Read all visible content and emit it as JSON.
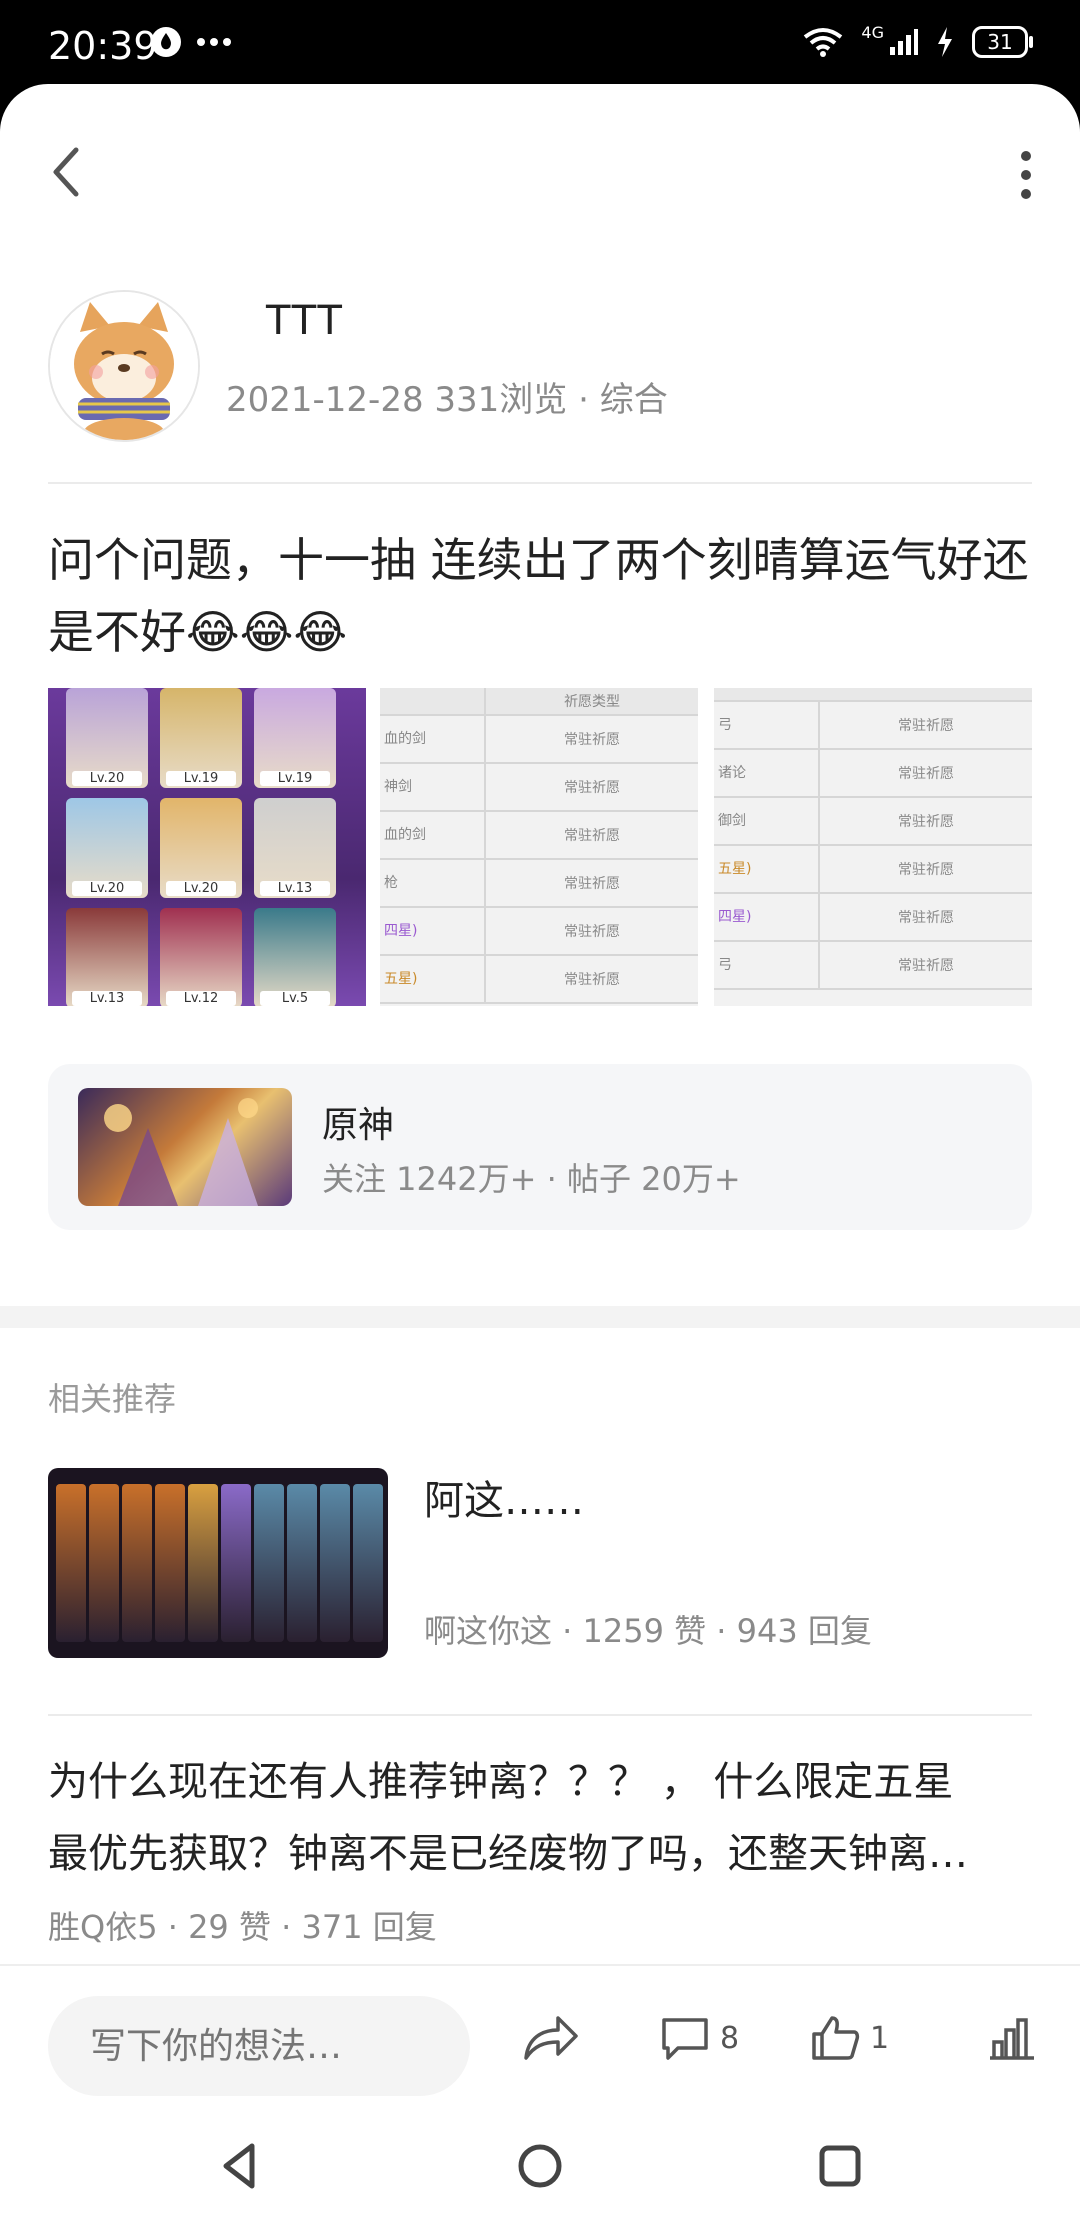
{
  "status_bar": {
    "time": "20:39",
    "network": "4G",
    "battery": "31"
  },
  "author": {
    "name": "TTT",
    "meta": "2021-12-28  331浏览 · 综合"
  },
  "post": {
    "title": "问个问题，十一抽 连续出了两个刻晴算运气好还是不好😂😂😂",
    "image1_levels": [
      "Lv.20",
      "Lv.19",
      "Lv.19",
      "Lv.20",
      "Lv.20",
      "Lv.13",
      "Lv.13",
      "Lv.12",
      "Lv.5"
    ],
    "table_header": "祈愿类型",
    "table_rows_1": [
      {
        "name": "血的剑",
        "type": "常驻祈愿"
      },
      {
        "name": "神剑",
        "type": "常驻祈愿"
      },
      {
        "name": "血的剑",
        "type": "常驻祈愿"
      },
      {
        "name": "枪",
        "type": "常驻祈愿"
      },
      {
        "name": "四星)",
        "type": "常驻祈愿"
      },
      {
        "name": "五星)",
        "type": "常驻祈愿"
      }
    ],
    "table_rows_2": [
      {
        "name": "弓",
        "type": "常驻祈愿"
      },
      {
        "name": "诸论",
        "type": "常驻祈愿"
      },
      {
        "name": "御剑",
        "type": "常驻祈愿"
      },
      {
        "name": "五星)",
        "type": "常驻祈愿"
      },
      {
        "name": "四星)",
        "type": "常驻祈愿"
      },
      {
        "name": "弓",
        "type": "常驻祈愿"
      }
    ]
  },
  "game_card": {
    "name": "原神",
    "stats": "关注  1242万+ · 帖子  20万+"
  },
  "related": {
    "title": "相关推荐",
    "items": [
      {
        "title": "阿这……",
        "meta": "啊这你这 · 1259 赞 · 943 回复"
      },
      {
        "title_line1": "为什么现在还有人推荐钟离？？？  ，  什么限定五星",
        "title_line2": "最优先获取？钟离不是已经废物了吗，还整天钟离…",
        "meta": "胜Q依5 · 29 赞 · 371 回复"
      }
    ]
  },
  "bottom_bar": {
    "input_placeholder": "写下你的想法…",
    "comment_count": "8",
    "like_count": "1"
  },
  "colors": {
    "text_primary": "#222222",
    "text_secondary": "#8a8a8a",
    "card_bg": "#f5f6f8"
  }
}
